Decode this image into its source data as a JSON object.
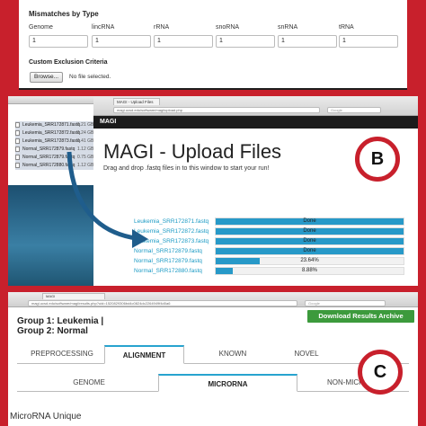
{
  "panelA": {
    "title": "Mismatches by Type",
    "fields": [
      {
        "label": "Genome",
        "value": "1"
      },
      {
        "label": "lincRNA",
        "value": "1"
      },
      {
        "label": "rRNA",
        "value": "1"
      },
      {
        "label": "snoRNA",
        "value": "1"
      },
      {
        "label": "snRNA",
        "value": "1"
      },
      {
        "label": "tRNA",
        "value": "1"
      }
    ],
    "exclusion_title": "Custom Exclusion Criteria",
    "browse_label": "Browse...",
    "no_file": "No file selected."
  },
  "panelB": {
    "finder_files": [
      {
        "name": "Leukemia_SRR172871.fastq",
        "size": "1.21 GB"
      },
      {
        "name": "Leukemia_SRR172872.fastq",
        "size": "1.24 GB"
      },
      {
        "name": "Leukemia_SRR172873.fastq",
        "size": "1.41 GB"
      },
      {
        "name": "Normal_SRR172879.fastq",
        "size": "1.12 GB"
      },
      {
        "name": "Normal_SRR172879.fastq",
        "size": "0.75 GB"
      },
      {
        "name": "Normal_SRR172880.fastq",
        "size": "1.12 GB"
      }
    ],
    "tab_title": "MAGI - Upload Files",
    "url": "magi.ucsd.edu/software/magi/upload.php",
    "search_placeholder": "Google",
    "nav_brand": "MAGI",
    "title": "MAGI - Upload Files",
    "instruction": "Drag and drop .fastq files in to this window to start your run!",
    "badge": "B",
    "uploads": [
      {
        "file": "Leukemia_SRR172871.fastq",
        "status": "Done",
        "progress": 1.0
      },
      {
        "file": "Leukemia_SRR172872.fastq",
        "status": "Done",
        "progress": 1.0
      },
      {
        "file": "Leukemia_SRR172873.fastq",
        "status": "Done",
        "progress": 1.0
      },
      {
        "file": "Normal_SRR172879.fastq",
        "status": "Done",
        "progress": 1.0
      },
      {
        "file": "Normal_SRR172879.fastq",
        "status": "23.64%",
        "progress": 0.2364
      },
      {
        "file": "Normal_SRR172880.fastq",
        "status": "8.88%",
        "progress": 0.0888
      }
    ],
    "colors": {
      "accent": "#2799c8",
      "link": "#1b9ac4",
      "arrow": "#1f5d8c"
    }
  },
  "panelC": {
    "tab_title": "MAGI",
    "url": "magi.ucsd.edu/software/magi/results.php?uid=1520829306bd4c0824dc2264949f4d0a6",
    "search_placeholder": "Google",
    "download_label": "Download Results Archive",
    "group_line1": "Group 1: Leukemia |",
    "group_line2": "Group 2: Normal",
    "tabs": [
      "PREPROCESSING",
      "ALIGNMENT",
      "KNOWN",
      "NOVEL"
    ],
    "active_tab": "ALIGNMENT",
    "subtabs": [
      "GENOME",
      "MICRORNA",
      "NON-MICRORNA"
    ],
    "active_subtab": "MICRORNA",
    "badge": "C",
    "heading": "MicroRNA Unique"
  },
  "colors": {
    "frame": "#c8202c",
    "download": "#3c9a3c",
    "tab_accent": "#27a3cf"
  }
}
